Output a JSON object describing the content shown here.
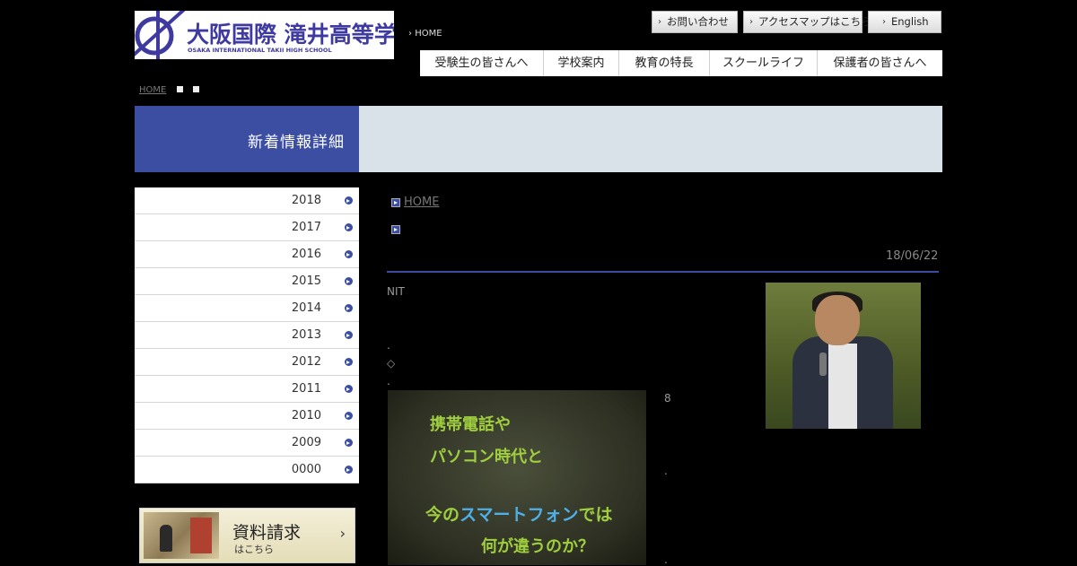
{
  "header": {
    "logo": {
      "name_ja": "大阪国際 滝井高等学校",
      "name_en": "OSAKA INTERNATIONAL TAKII HIGH SCHOOL"
    },
    "home_link": "HOME",
    "utility_links": [
      "お問い合わせ",
      "アクセスマップはこちら",
      "English"
    ],
    "global_nav": [
      "受験生の皆さんへ",
      "学校案内",
      "教育の特長",
      "スクールライフ",
      "保護者の皆さんへ"
    ]
  },
  "breadcrumb_top": {
    "home": "HOME"
  },
  "page_banner": {
    "title": "新着情報詳細"
  },
  "sidebar": {
    "years": [
      "2018",
      "2017",
      "2016",
      "2015",
      "2014",
      "2013",
      "2012",
      "2011",
      "2010",
      "2009",
      "0000"
    ],
    "request_banner": {
      "title": "資料請求",
      "subtitle": "はこちら",
      "arrow": "›"
    }
  },
  "article": {
    "breadcrumb_home": "HOME",
    "date": "18/06/22",
    "lines": [
      "NIT",
      ".",
      "◇",
      ".",
      "8",
      ".",
      ".",
      "."
    ],
    "slide_text": {
      "line1": "携帯電話や",
      "line2": "パソコン時代と",
      "line3_pre": "今の",
      "line3_highlight": "スマートフォン",
      "line3_post": "では",
      "line4": "何が違うのか？"
    }
  },
  "colors": {
    "brand_blue": "#3b4ea2",
    "banner_light": "#d9e2e9",
    "background": "#000000"
  }
}
